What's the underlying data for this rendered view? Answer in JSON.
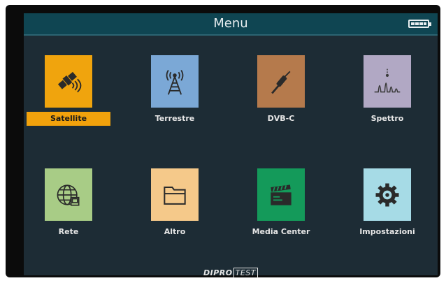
{
  "header": {
    "title": "Menu",
    "battery_icon": "battery-icon"
  },
  "tiles": [
    {
      "label": "Satellite",
      "icon": "satellite-icon",
      "color": "#f0a40d",
      "selected": true
    },
    {
      "label": "Terrestre",
      "icon": "antenna-tower-icon",
      "color": "#7ba8d6",
      "selected": false
    },
    {
      "label": "DVB-C",
      "icon": "coax-cable-icon",
      "color": "#b57a4c",
      "selected": false
    },
    {
      "label": "Spettro",
      "icon": "spectrum-icon",
      "color": "#b1a8c4",
      "selected": false
    },
    {
      "label": "Rete",
      "icon": "network-globe-icon",
      "color": "#a8cc86",
      "selected": false
    },
    {
      "label": "Altro",
      "icon": "folder-icon",
      "color": "#f5c98a",
      "selected": false
    },
    {
      "label": "Media Center",
      "icon": "clapperboard-icon",
      "color": "#149a5a",
      "selected": false
    },
    {
      "label": "Impostazioni",
      "icon": "gear-icon",
      "color": "#a6dbe6",
      "selected": false
    }
  ],
  "footer": {
    "brand": "DIPRO",
    "brand_suffix": "TEST"
  }
}
